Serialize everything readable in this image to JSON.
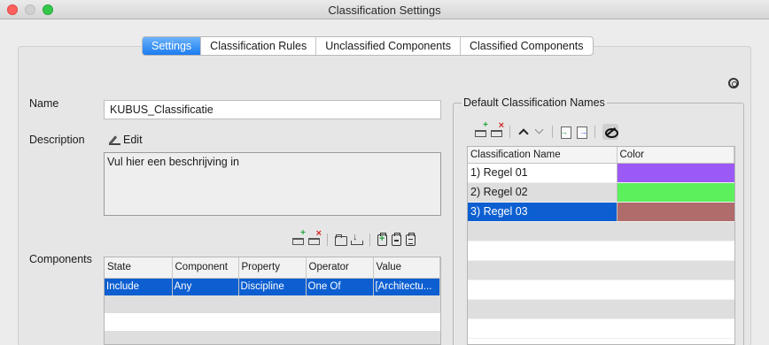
{
  "window": {
    "title": "Classification Settings"
  },
  "tabs": [
    {
      "label": "Settings",
      "active": true
    },
    {
      "label": "Classification Rules",
      "active": false
    },
    {
      "label": "Unclassified Components",
      "active": false
    },
    {
      "label": "Classified Components",
      "active": false
    }
  ],
  "settings": {
    "name_label": "Name",
    "name_value": "KUBUS_Classificatie",
    "description_label": "Description",
    "edit_label": "Edit",
    "description_text": "Vul hier een beschrijving in",
    "components_label": "Components"
  },
  "components_table": {
    "headers": [
      "State",
      "Component",
      "Property",
      "Operator",
      "Value"
    ],
    "rows": [
      [
        "Include",
        "Any",
        "Discipline",
        "One Of",
        "[Architectu..."
      ]
    ]
  },
  "default_names": {
    "title": "Default Classification Names",
    "headers": [
      "Classification Name",
      "Color"
    ],
    "rows": [
      {
        "name": "1) Regel 01",
        "color": "#9b59f5"
      },
      {
        "name": "2) Regel 02",
        "color": "#5cf05c"
      },
      {
        "name": "3) Regel 03",
        "color": "#b06b6b"
      }
    ]
  },
  "icons": {
    "help": "help-icon",
    "edit": "pen-icon",
    "add_row": "add-row-icon",
    "delete_row": "delete-row-icon",
    "open": "folder-icon",
    "save": "download-icon",
    "move_up": "chevron-up-icon",
    "move_down": "chevron-down-icon",
    "import": "import-icon",
    "export": "export-icon",
    "visibility": "eye-slash-icon"
  }
}
